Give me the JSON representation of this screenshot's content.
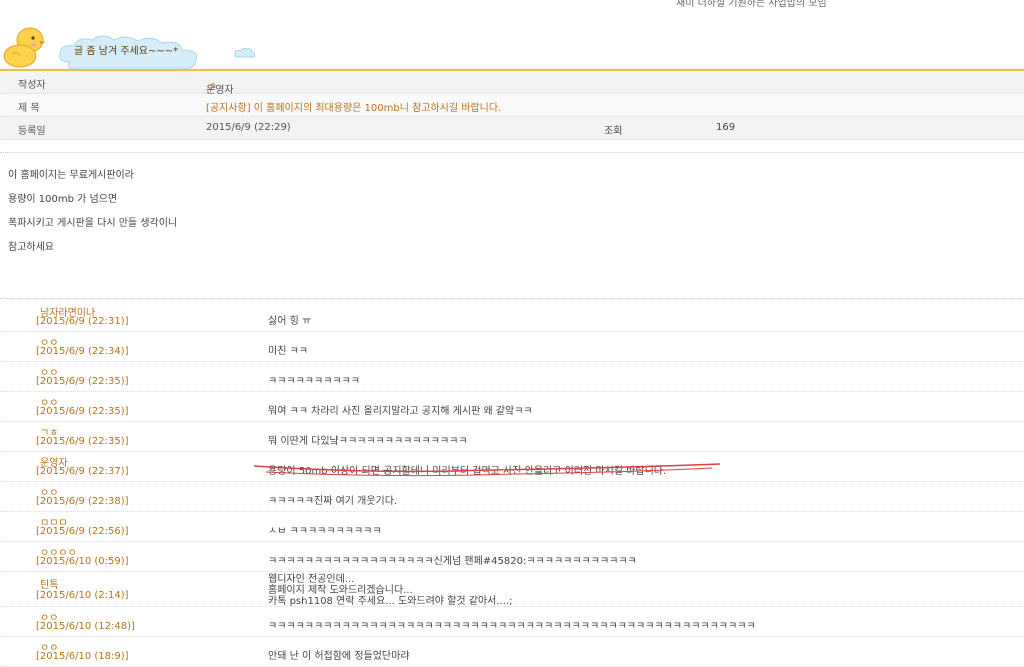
{
  "top_note": "재미 더하실 기원하는 사업밥의 모임",
  "logo": {
    "cloud_text": "글 좀 남겨 주세요~~~*"
  },
  "info": {
    "author_label": "작성자",
    "author_value": "운영자",
    "title_label": "제 목",
    "title_value": "[공지사항] 이 홈페이지의 최대용량은 100mb니 참고하시길 바랍니다.",
    "date_label": "등록일",
    "date_value": "2015/6/9 (22:29)",
    "views_label": "조회",
    "views_value": "169"
  },
  "body_lines": [
    "이 홈페이지는 무료게시판이라",
    "용량이 100mb 가 넘으면",
    "폭파시키고 게시판을 다시 만들 생각이니",
    "참고하세요"
  ],
  "comments": [
    {
      "author": "남자라면미나",
      "date": "[2015/6/9 (22:31)]",
      "text": "싫어 힝 ㅠ"
    },
    {
      "author": "ㅇㅇ",
      "date": "[2015/6/9 (22:34)]",
      "text": "미친 ㅋㅋ"
    },
    {
      "author": "ㅇㅇ",
      "date": "[2015/6/9 (22:35)]",
      "text": "ㅋㅋㅋㅋㅋㅋㅋㅋㅋㅋ"
    },
    {
      "author": "ㅇㅇ",
      "date": "[2015/6/9 (22:35)]",
      "text": "뭐여 ㅋㅋ 차라리 사진 올리지말라고 공지해 게시판 왜 같앜ㅋㅋ"
    },
    {
      "author": "ㄱㅎ",
      "date": "[2015/6/9 (22:35)]",
      "text": "뭐 이딴게 다있냨ㅋㅋㅋㅋㅋㅋㅋㅋㅋㅋㅋㅋㅋㅋ"
    },
    {
      "author": "운영자",
      "date": "[2015/6/9 (22:37)]",
      "text": "용량이 50mb 이상이 되면 공지할테니 미리부터 겁먹고 사진 안올리고 이러진 마시길 바랍니다."
    },
    {
      "author": "ㅇㅇ",
      "date": "[2015/6/9 (22:38)]",
      "text": "ㅋㅋㅋㅋㅋ진짜 여기 개웃기다."
    },
    {
      "author": "ㅁㅁㅁ",
      "date": "[2015/6/9 (22:56)]",
      "text": "ㅅㅂ ㅋㅋㅋㅋㅋㅋㅋㅋㅋㅋ"
    },
    {
      "author": "ㅇㅇㅇㅇ",
      "date": "[2015/6/10 (0:59)]",
      "text": "ㅋㅋㅋㅋㅋㅋㅋㅋㅋㅋㅋㅋㅋㅋㅋㅋㅋㅋ신게넘 팬페#45820:ㅋㅋㅋㅋㅋㅋㅋㅋㅋㅋㅋㅋ"
    },
    {
      "author": "틴톡",
      "date": "[2015/6/10 (2:14)]",
      "text_lines": [
        "웹디자인 전공인데...",
        "홈페이지 제작 도와드리겠습니다...",
        "카톡 psh1108 연락 주세요... 도와드려야 할것 같아서....;"
      ]
    },
    {
      "author": "ㅇㅇ",
      "date": "[2015/6/10 (12:48)]",
      "text": "ㅋㅋㅋㅋㅋㅋㅋㅋㅋㅋㅋㅋㅋㅋㅋㅋㅋㅋㅋㅋㅋㅋㅋㅋㅋㅋㅋㅋㅋㅋㅋㅋㅋㅋㅋㅋㅋㅋㅋㅋㅋㅋㅋㅋㅋㅋㅋㅋㅋㅋㅋㅋㅋ"
    },
    {
      "author": "ㅇㅇ",
      "date": "[2015/6/10 (18:9)]",
      "text": "안돼 난 이 허접함에 정들었단마랴"
    }
  ],
  "colors": {
    "accent_yellow": "#e6c24a",
    "author_orange": "#b8731c",
    "annotation_red": "#e04040"
  }
}
